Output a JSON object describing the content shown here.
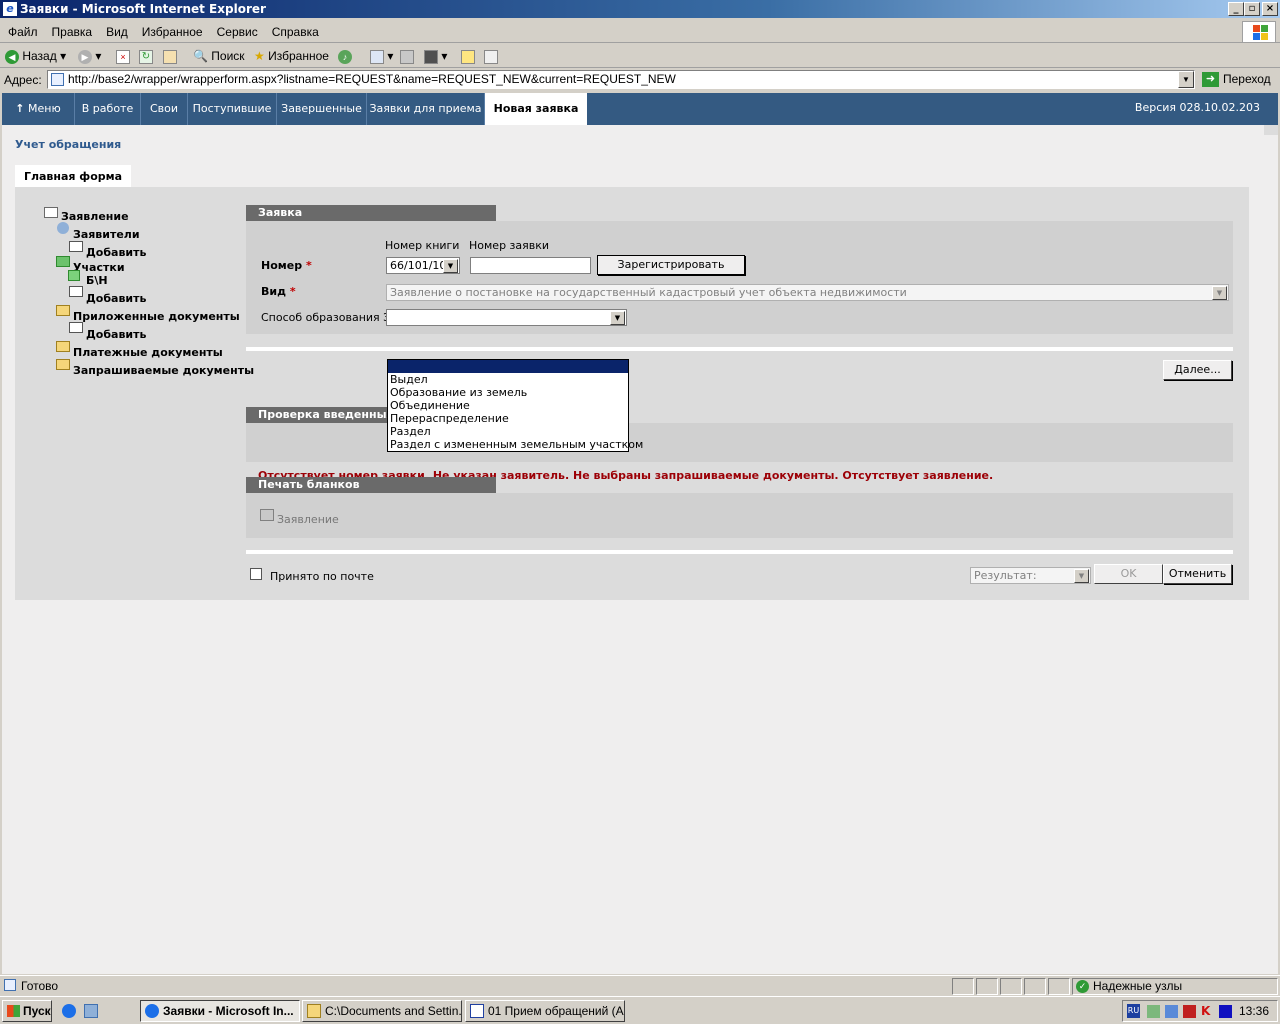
{
  "window": {
    "title": "Заявки - Microsoft Internet Explorer"
  },
  "menu": [
    "Файл",
    "Правка",
    "Вид",
    "Избранное",
    "Сервис",
    "Справка"
  ],
  "toolbar": {
    "back": "Назад",
    "search": "Поиск",
    "favorites": "Избранное"
  },
  "address": {
    "label": "Адрес:",
    "url": "http://base2/wrapper/wrapperform.aspx?listname=REQUEST&name=REQUEST_NEW&current=REQUEST_NEW",
    "go": "Переход"
  },
  "nav": {
    "tabs": [
      "Меню",
      "В работе",
      "Свои",
      "Поступившие",
      "Завершенные",
      "Заявки для приема",
      "Новая заявка"
    ],
    "version": "Версия 028.10.02.203"
  },
  "page": {
    "title": "Учет обращения",
    "main_tab": "Главная форма"
  },
  "tree": {
    "root": "Заявление",
    "applicants": "Заявители",
    "add1": "Добавить",
    "plots": "Участки",
    "plot_item": "Б\\Н",
    "add2": "Добавить",
    "attached_docs": "Приложенные документы",
    "add3": "Добавить",
    "payment_docs": "Платежные документы",
    "requested_docs": "Запрашиваемые документы"
  },
  "form": {
    "section_title": "Заявка",
    "book_no_label": "Номер книги",
    "request_no_label": "Номер заявки",
    "number_label": "Номер",
    "book_value": "66/101/10",
    "request_value": "",
    "register_button": "Зарегистрировать",
    "type_label": "Вид",
    "type_value": "Заявление о постановке на государственный кадастровый учет объекта недвижимости",
    "method_label": "Способ образования ЗУ",
    "method_value": "",
    "method_options": [
      "",
      "Выдел",
      "Образование из земель",
      "Объединение",
      "Перераспределение",
      "Раздел",
      "Раздел с измененным земельным участком"
    ],
    "next_button": "Далее..."
  },
  "check": {
    "section_title": "Проверка введенных данных",
    "error": "Отсутствует номер заявки. Не указан заявитель. Не выбраны запрашиваемые документы. Отсутствует заявление."
  },
  "print": {
    "section_title": "Печать бланков",
    "item": "Заявление"
  },
  "footer": {
    "mail_checkbox": "Принято по почте",
    "mail_checked": false,
    "result_placeholder": "Результат:",
    "ok": "OK",
    "cancel": "Отменить"
  },
  "status": {
    "text": "Готово",
    "zone": "Надежные узлы"
  },
  "taskbar": {
    "start": "Пуск",
    "tasks": [
      "Заявки - Microsoft In...",
      "C:\\Documents and Settin...",
      "01 Прием обращений (А..."
    ],
    "lang": "RU",
    "time": "13:36"
  },
  "colors": {
    "nav": "#345a82",
    "title_gradient_start": "#0a246a",
    "error": "#9c0006",
    "section_header": "#6a6a6a"
  }
}
